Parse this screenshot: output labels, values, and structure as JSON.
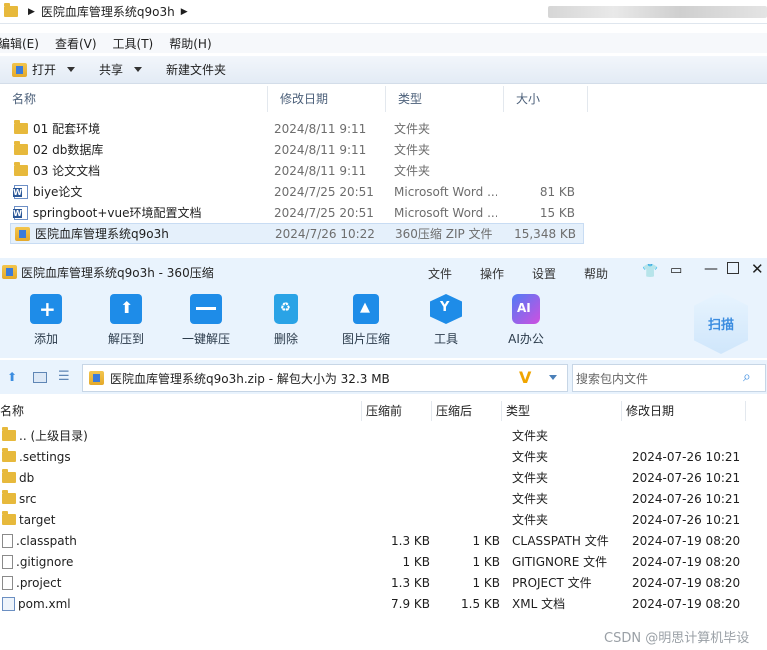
{
  "explorer": {
    "breadcrumb": "医院血库管理系统q9o3h",
    "menu": [
      "编辑(E)",
      "查看(V)",
      "工具(T)",
      "帮助(H)"
    ],
    "toolbar": {
      "open": "打开",
      "share": "共享",
      "new_folder": "新建文件夹"
    },
    "columns": {
      "name": "名称",
      "date": "修改日期",
      "type": "类型",
      "size": "大小"
    },
    "files": [
      {
        "icon": "folder-icon",
        "name": "01 配套环境",
        "date": "2024/8/11 9:11",
        "type": "文件夹",
        "size": ""
      },
      {
        "icon": "folder-icon",
        "name": "02 db数据库",
        "date": "2024/8/11 9:11",
        "type": "文件夹",
        "size": ""
      },
      {
        "icon": "folder-icon",
        "name": "03 论文文档",
        "date": "2024/8/11 9:11",
        "type": "文件夹",
        "size": ""
      },
      {
        "icon": "word-doc-icon",
        "name": "biye论文",
        "date": "2024/7/25 20:51",
        "type": "Microsoft Word ...",
        "size": "81 KB"
      },
      {
        "icon": "word-doc-icon",
        "name": "springboot+vue环境配置文档",
        "date": "2024/7/25 20:51",
        "type": "Microsoft Word ...",
        "size": "15 KB"
      },
      {
        "icon": "zip-icon",
        "name": "医院血库管理系统q9o3h",
        "date": "2024/7/26 10:22",
        "type": "360压缩 ZIP 文件",
        "size": "15,348 KB"
      }
    ]
  },
  "zip": {
    "title": "医院血库管理系统q9o3h - 360压缩",
    "menu": [
      "文件",
      "操作",
      "设置",
      "帮助"
    ],
    "ribbon": [
      "添加",
      "解压到",
      "一键解压",
      "删除",
      "图片压缩",
      "工具",
      "AI办公"
    ],
    "scan_label": "扫描",
    "path": "医院血库管理系统q9o3h.zip - 解包大小为 32.3 MB",
    "search_placeholder": "搜索包内文件",
    "columns": {
      "name": "名称",
      "packed": "压缩前",
      "compressed": "压缩后",
      "type": "类型",
      "date": "修改日期"
    },
    "rows": [
      {
        "icon": "folder-icon",
        "name": ".. (上级目录)",
        "before": "",
        "after": "",
        "type": "文件夹",
        "date": ""
      },
      {
        "icon": "folder-icon",
        "name": ".settings",
        "before": "",
        "after": "",
        "type": "文件夹",
        "date": "2024-07-26 10:21"
      },
      {
        "icon": "folder-icon",
        "name": "db",
        "before": "",
        "after": "",
        "type": "文件夹",
        "date": "2024-07-26 10:21"
      },
      {
        "icon": "folder-icon",
        "name": "src",
        "before": "",
        "after": "",
        "type": "文件夹",
        "date": "2024-07-26 10:21"
      },
      {
        "icon": "folder-icon",
        "name": "target",
        "before": "",
        "after": "",
        "type": "文件夹",
        "date": "2024-07-26 10:21"
      },
      {
        "icon": "file-icon",
        "name": ".classpath",
        "before": "1.3 KB",
        "after": "1 KB",
        "type": "CLASSPATH 文件",
        "date": "2024-07-19 08:20"
      },
      {
        "icon": "file-icon",
        "name": ".gitignore",
        "before": "1 KB",
        "after": "1 KB",
        "type": "GITIGNORE 文件",
        "date": "2024-07-19 08:20"
      },
      {
        "icon": "file-icon",
        "name": ".project",
        "before": "1.3 KB",
        "after": "1 KB",
        "type": "PROJECT 文件",
        "date": "2024-07-19 08:20"
      },
      {
        "icon": "xml-file-icon",
        "name": "pom.xml",
        "before": "7.9 KB",
        "after": "1.5 KB",
        "type": "XML 文档",
        "date": "2024-07-19 08:20"
      }
    ]
  },
  "watermark": "CSDN @明思计算机毕设"
}
